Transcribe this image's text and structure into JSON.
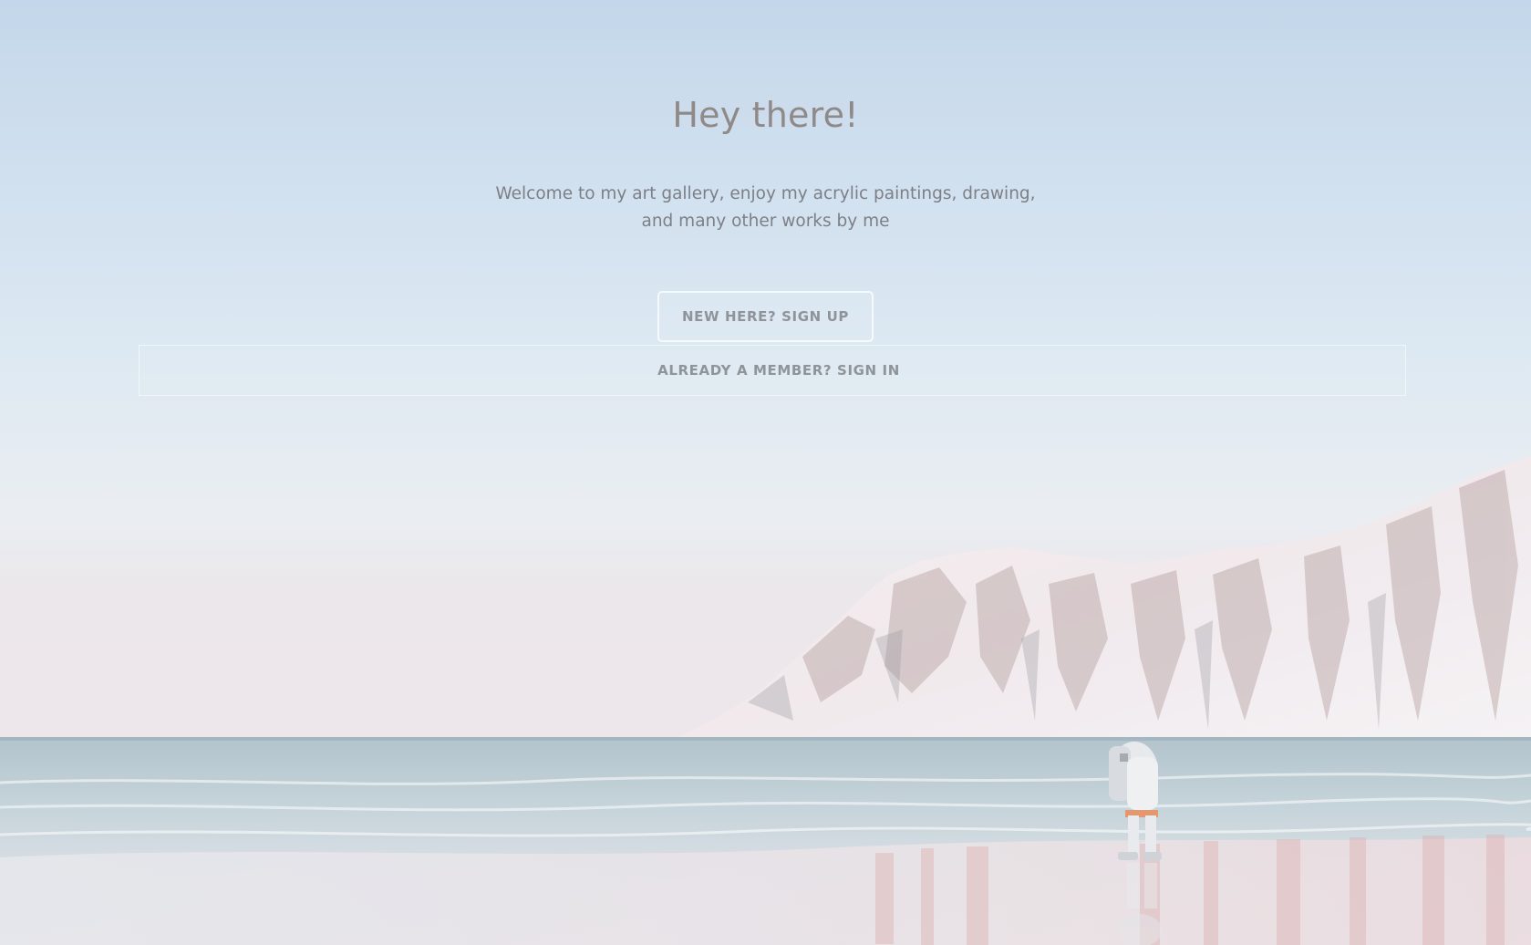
{
  "hero": {
    "title": "Hey there!",
    "subtitle": "Welcome to my art gallery, enjoy my acrylic paintings, drawing, and many other works by me"
  },
  "actions": {
    "signup_label": "NEW HERE? SIGN UP",
    "signin_label": "ALREADY A MEMBER? SIGN IN"
  },
  "colors": {
    "sky_top": "#bcd2e7",
    "sky_bottom": "#e7ecf0",
    "text_title": "#8f8a88",
    "text_body": "#7c7f86",
    "button_text": "#8e9499"
  },
  "background": {
    "scene": "beach-mountain-astronaut-photo"
  }
}
